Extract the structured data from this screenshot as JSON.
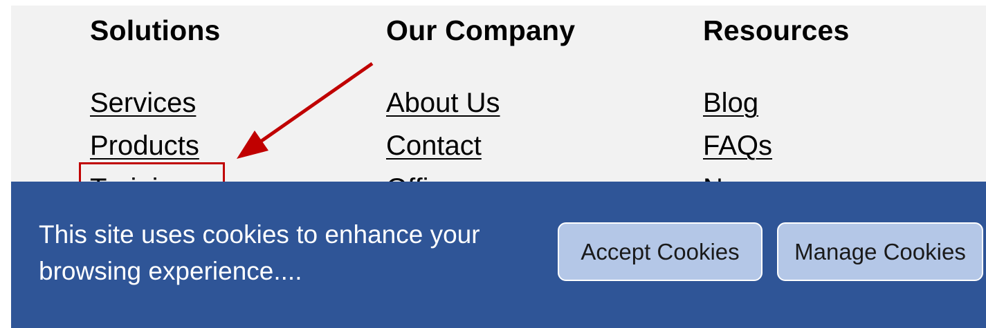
{
  "footer": {
    "columns": [
      {
        "heading": "Solutions",
        "links": [
          "Services",
          "Products",
          "Training"
        ]
      },
      {
        "heading": "Our Company",
        "links": [
          "About Us",
          "Contact",
          "Offices"
        ]
      },
      {
        "heading": "Resources",
        "links": [
          "Blog",
          "FAQs",
          "Newsroom"
        ]
      }
    ]
  },
  "annotation": {
    "color": "#c00000",
    "highlighted_link": "Training"
  },
  "cookie_banner": {
    "background": "#2f5597",
    "message": "This site uses cookies to enhance your browsing experience....",
    "accept_label": "Accept Cookies",
    "manage_label": "Manage Cookies",
    "button_color": "#b4c7e7"
  }
}
